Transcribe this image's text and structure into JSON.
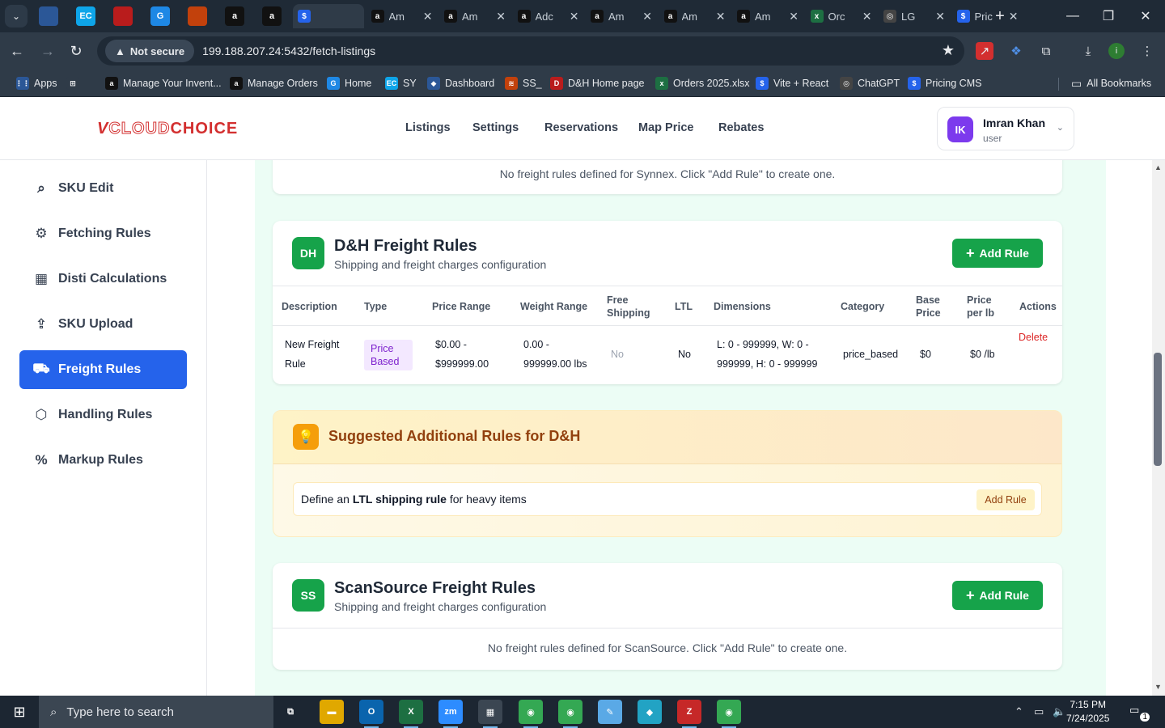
{
  "browser": {
    "tabs": [
      {
        "title": "",
        "icon": "favicon-generic",
        "color": "#2b5797"
      },
      {
        "title": "",
        "icon": "favicon-ec",
        "color": "#0ea5e9",
        "glyph": "EC"
      },
      {
        "title": "",
        "icon": "favicon-dh",
        "color": "#b91c1c"
      },
      {
        "title": "",
        "icon": "favicon-g",
        "color": "#1e88e5",
        "glyph": "G"
      },
      {
        "title": "",
        "icon": "favicon-ss",
        "color": "#c2410c"
      },
      {
        "title": "",
        "icon": "amazon-icon",
        "color": "#111",
        "glyph": "a"
      },
      {
        "title": "",
        "icon": "amazon-icon",
        "color": "#111",
        "glyph": "a"
      },
      {
        "title": "",
        "icon": "pricing-icon",
        "color": "#2563eb",
        "glyph": "$"
      },
      {
        "title": "Am",
        "icon": "amazon-icon",
        "color": "#111",
        "glyph": "a"
      },
      {
        "title": "Am",
        "icon": "amazon-icon",
        "color": "#111",
        "glyph": "a"
      },
      {
        "title": "Adc",
        "icon": "amazon-icon",
        "color": "#111",
        "glyph": "a"
      },
      {
        "title": "Am",
        "icon": "amazon-icon",
        "color": "#111",
        "glyph": "a"
      },
      {
        "title": "Am",
        "icon": "amazon-icon",
        "color": "#111",
        "glyph": "a"
      },
      {
        "title": "Am",
        "icon": "amazon-icon",
        "color": "#111",
        "glyph": "a"
      },
      {
        "title": "Orc",
        "icon": "excel-icon",
        "color": "#1d6f42",
        "glyph": "x"
      },
      {
        "title": "LG",
        "icon": "openai-icon",
        "color": "#444",
        "glyph": "◎"
      },
      {
        "title": "Pric",
        "icon": "pricing-icon",
        "color": "#2563eb",
        "glyph": "$"
      }
    ],
    "address": {
      "security_label": "Not secure",
      "url": "199.188.207.24:5432/fetch-listings"
    },
    "bookmarks": [
      {
        "label": "Apps",
        "icon": "apps-grid-icon",
        "color": "#2b5797",
        "glyph": "⋮⋮"
      },
      {
        "label": "",
        "icon": "all-apps-icon",
        "color": "#2f3b48",
        "glyph": "⊞"
      },
      {
        "label": "Manage Your Invent...",
        "icon": "amazon-icon",
        "color": "#111",
        "glyph": "a"
      },
      {
        "label": "Manage Orders",
        "icon": "amazon-icon",
        "color": "#111",
        "glyph": "a"
      },
      {
        "label": "Home",
        "icon": "favicon-g",
        "color": "#1e88e5",
        "glyph": "G"
      },
      {
        "label": "SY",
        "icon": "favicon-ec",
        "color": "#0ea5e9",
        "glyph": "EC"
      },
      {
        "label": "Dashboard",
        "icon": "favicon-generic",
        "color": "#2b5797",
        "glyph": "◆"
      },
      {
        "label": "SS_",
        "icon": "favicon-ss",
        "color": "#c2410c",
        "glyph": "≋"
      },
      {
        "label": "D&H Home page",
        "icon": "favicon-dh",
        "color": "#b91c1c",
        "glyph": "D"
      },
      {
        "label": "Orders 2025.xlsx",
        "icon": "excel-icon",
        "color": "#1d6f42",
        "glyph": "x"
      },
      {
        "label": "Vite + React",
        "icon": "pricing-icon",
        "color": "#2563eb",
        "glyph": "$"
      },
      {
        "label": "ChatGPT",
        "icon": "openai-icon",
        "color": "#444",
        "glyph": "◎"
      },
      {
        "label": "Pricing CMS",
        "icon": "pricing-icon",
        "color": "#2563eb",
        "glyph": "$"
      }
    ],
    "all_bookmarks_label": "All Bookmarks"
  },
  "app": {
    "logo": {
      "v": "V",
      "cloud": "CLOUD",
      "choice": "CHOICE"
    },
    "nav": [
      "Listings",
      "Settings",
      "Reservations",
      "Map Price",
      "Rebates"
    ],
    "user": {
      "initials": "IK",
      "name": "Imran Khan",
      "role": "user"
    }
  },
  "sidebar": {
    "items": [
      {
        "label": "SKU Edit",
        "icon": "search-icon",
        "glyph": "⌕"
      },
      {
        "label": "Fetching Rules",
        "icon": "gear-icon",
        "glyph": "⚙"
      },
      {
        "label": "Disti Calculations",
        "icon": "calculator-icon",
        "glyph": "▦"
      },
      {
        "label": "SKU Upload",
        "icon": "upload-icon",
        "glyph": "⇪"
      },
      {
        "label": "Freight Rules",
        "icon": "truck-icon",
        "glyph": "⛟"
      },
      {
        "label": "Handling Rules",
        "icon": "box-icon",
        "glyph": "⬡"
      },
      {
        "label": "Markup Rules",
        "icon": "percent-icon",
        "glyph": "%"
      }
    ],
    "active": "Freight Rules"
  },
  "synnex": {
    "empty_message": "No freight rules defined for Synnex. Click \"Add Rule\" to create one."
  },
  "dh": {
    "badge": "DH",
    "title": "D&H Freight Rules",
    "subtitle": "Shipping and freight charges configuration",
    "add_label": "Add Rule",
    "columns": [
      "Description",
      "Type",
      "Price Range",
      "Weight Range",
      "Free Shipping",
      "LTL",
      "Dimensions",
      "Category",
      "Base Price",
      "Price per lb",
      "Actions"
    ],
    "rows": [
      {
        "description": "New Freight Rule",
        "type": "Price Based",
        "price_range": "$0.00 - $999999.00",
        "weight_range": "0.00 - 999999.00 lbs",
        "free_shipping": "No",
        "ltl": "No",
        "dimensions": "L: 0 - 999999, W: 0 - 999999, H: 0 - 999999",
        "category": "price_based",
        "base_price": "$0",
        "price_per_lb": "$0 /lb",
        "action": "Delete"
      }
    ]
  },
  "suggestions": {
    "title": "Suggested Additional Rules for D&H",
    "items": [
      {
        "prefix": "Define an ",
        "bold": "LTL shipping rule",
        "suffix": " for heavy items",
        "button": "Add Rule"
      }
    ]
  },
  "scansource": {
    "badge": "SS",
    "title": "ScanSource Freight Rules",
    "subtitle": "Shipping and freight charges configuration",
    "add_label": "Add Rule",
    "empty_message": "No freight rules defined for ScanSource. Click \"Add Rule\" to create one."
  },
  "taskbar": {
    "search_placeholder": "Type here to search",
    "apps": [
      {
        "name": "task-view-icon",
        "glyph": "⧉",
        "color": "#1c2632"
      },
      {
        "name": "file-explorer-icon",
        "glyph": "▬",
        "color": "#e0a800"
      },
      {
        "name": "outlook-icon",
        "glyph": "O",
        "color": "#0a64ad"
      },
      {
        "name": "excel-icon",
        "glyph": "X",
        "color": "#1d6f42"
      },
      {
        "name": "zoom-icon",
        "glyph": "zm",
        "color": "#2d8cff"
      },
      {
        "name": "calculator-icon",
        "glyph": "▦",
        "color": "#3b4652"
      },
      {
        "name": "chrome-icon",
        "glyph": "◉",
        "color": "#34a853"
      },
      {
        "name": "chrome-icon",
        "glyph": "◉",
        "color": "#34a853"
      },
      {
        "name": "notepad-icon",
        "glyph": "✎",
        "color": "#5aa9e6"
      },
      {
        "name": "app-diamond-icon",
        "glyph": "◆",
        "color": "#22a3c4"
      },
      {
        "name": "filezilla-icon",
        "glyph": "Z",
        "color": "#c62828"
      },
      {
        "name": "chrome-profile-icon",
        "glyph": "◉",
        "color": "#34a853"
      }
    ],
    "time": "7:15 PM",
    "date": "7/24/2025",
    "notification_count": "1"
  }
}
